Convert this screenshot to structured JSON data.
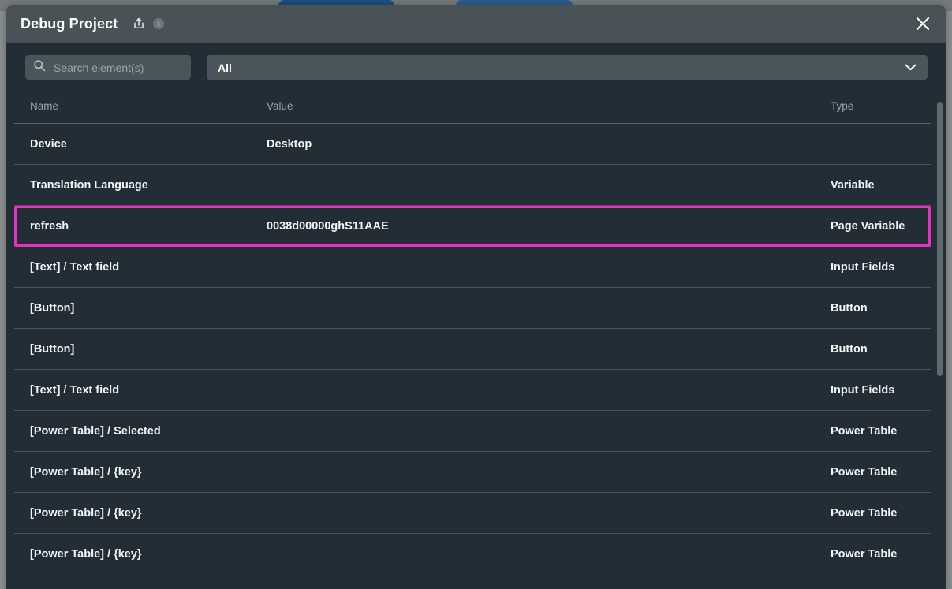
{
  "window": {
    "title": "Debug Project",
    "icons": {
      "export": "export-icon",
      "info": "i",
      "close": "close-icon"
    }
  },
  "background": {
    "tabs": [
      "",
      ""
    ]
  },
  "toolbar": {
    "search": {
      "placeholder": "Search element(s)",
      "value": "",
      "icon": "search-icon"
    },
    "filter": {
      "selected": "All",
      "options": [
        "All"
      ],
      "icon": "chevron-down-icon"
    }
  },
  "table": {
    "columns": [
      "Name",
      "Value",
      "Type"
    ],
    "rows": [
      {
        "name": "Device",
        "value": "Desktop",
        "type": "",
        "highlighted": false
      },
      {
        "name": "Translation Language",
        "value": "",
        "type": "Variable",
        "highlighted": false
      },
      {
        "name": "refresh",
        "value": "0038d00000ghS11AAE",
        "type": "Page Variable",
        "highlighted": true
      },
      {
        "name": "[Text] / Text field",
        "value": "",
        "type": "Input Fields",
        "highlighted": false
      },
      {
        "name": "[Button]",
        "value": "",
        "type": "Button",
        "highlighted": false
      },
      {
        "name": "[Button]",
        "value": "",
        "type": "Button",
        "highlighted": false
      },
      {
        "name": "[Text] / Text field",
        "value": "",
        "type": "Input Fields",
        "highlighted": false
      },
      {
        "name": "[Power Table] / Selected",
        "value": "",
        "type": "Power Table",
        "highlighted": false
      },
      {
        "name": "[Power Table] / {key}",
        "value": "",
        "type": "Power Table",
        "highlighted": false
      },
      {
        "name": "[Power Table] / {key}",
        "value": "",
        "type": "Power Table",
        "highlighted": false
      },
      {
        "name": "[Power Table] / {key}",
        "value": "",
        "type": "Power Table",
        "highlighted": false
      }
    ]
  },
  "colors": {
    "titlebar": "#485257",
    "body": "#232d35",
    "accent_highlight": "#e830c4",
    "control": "#4a555b",
    "muted_text": "#9aa6ab"
  }
}
